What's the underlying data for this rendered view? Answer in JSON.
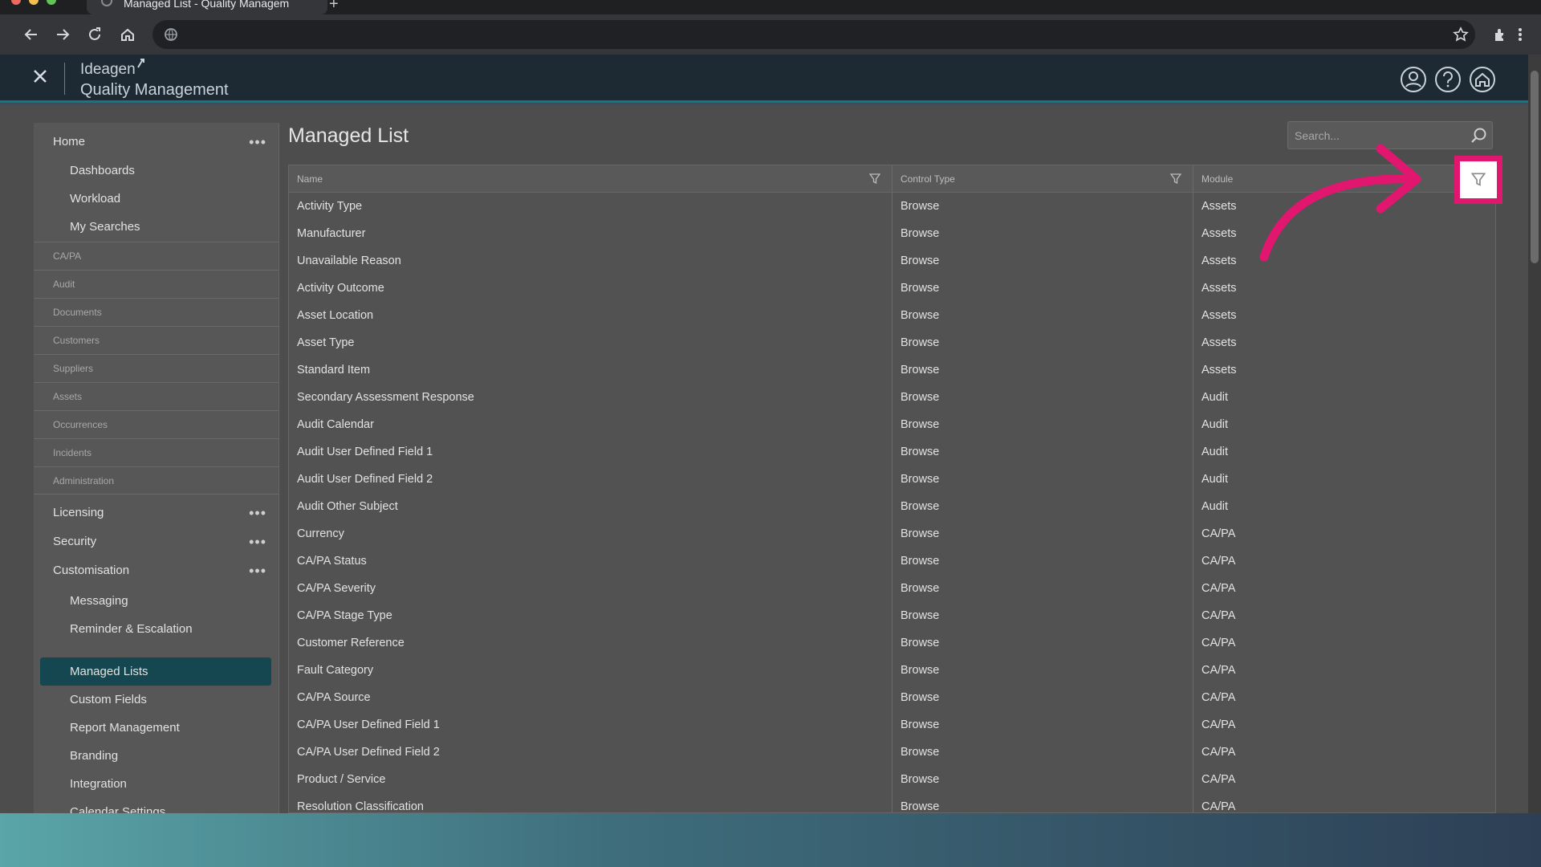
{
  "browser": {
    "tab_title": "Managed List - Quality Managem",
    "new_tab": "+",
    "icons": [
      "back-icon",
      "forward-icon",
      "reload-icon",
      "home-icon",
      "site-info-icon",
      "star-icon",
      "extensions-icon",
      "menu-icon"
    ]
  },
  "app": {
    "brand_top": "Ideagen",
    "brand_bottom": "Quality Management",
    "header_icons": [
      "user-icon",
      "help-icon",
      "home-icon"
    ]
  },
  "sidebar": {
    "home": "Home",
    "home_children": [
      "Dashboards",
      "Workload",
      "My Searches"
    ],
    "categories": [
      "CA/PA",
      "Audit",
      "Documents",
      "Customers",
      "Suppliers",
      "Assets",
      "Occurrences",
      "Incidents",
      "Administration"
    ],
    "groups": [
      "Licensing",
      "Security",
      "Customisation"
    ],
    "customisation_children": [
      "Messaging",
      "Reminder & Escalation",
      "Managed Lists",
      "Custom Fields",
      "Report Management",
      "Branding",
      "Integration",
      "Calendar Settings"
    ],
    "active": "Managed Lists"
  },
  "main": {
    "title": "Managed List",
    "search_placeholder": "Search...",
    "columns": [
      "Name",
      "Control Type",
      "Module"
    ],
    "rows": [
      [
        "Activity Type",
        "Browse",
        "Assets"
      ],
      [
        "Manufacturer",
        "Browse",
        "Assets"
      ],
      [
        "Unavailable Reason",
        "Browse",
        "Assets"
      ],
      [
        "Activity Outcome",
        "Browse",
        "Assets"
      ],
      [
        "Asset Location",
        "Browse",
        "Assets"
      ],
      [
        "Asset Type",
        "Browse",
        "Assets"
      ],
      [
        "Standard Item",
        "Browse",
        "Assets"
      ],
      [
        "Secondary Assessment Response",
        "Browse",
        "Audit"
      ],
      [
        "Audit Calendar",
        "Browse",
        "Audit"
      ],
      [
        "Audit User Defined Field 1",
        "Browse",
        "Audit"
      ],
      [
        "Audit User Defined Field 2",
        "Browse",
        "Audit"
      ],
      [
        "Audit Other Subject",
        "Browse",
        "Audit"
      ],
      [
        "Currency",
        "Browse",
        "CA/PA"
      ],
      [
        "CA/PA Status",
        "Browse",
        "CA/PA"
      ],
      [
        "CA/PA Severity",
        "Browse",
        "CA/PA"
      ],
      [
        "CA/PA Stage Type",
        "Browse",
        "CA/PA"
      ],
      [
        "Customer Reference",
        "Browse",
        "CA/PA"
      ],
      [
        "Fault Category",
        "Browse",
        "CA/PA"
      ],
      [
        "CA/PA Source",
        "Browse",
        "CA/PA"
      ],
      [
        "CA/PA User Defined Field 1",
        "Browse",
        "CA/PA"
      ],
      [
        "CA/PA User Defined Field 2",
        "Browse",
        "CA/PA"
      ],
      [
        "Product / Service",
        "Browse",
        "CA/PA"
      ],
      [
        "Resolution Classification",
        "Browse",
        "CA/PA"
      ]
    ]
  },
  "colors": {
    "highlight": "#e0166f",
    "active_nav": "#14474f",
    "header": "#1d2a34"
  }
}
